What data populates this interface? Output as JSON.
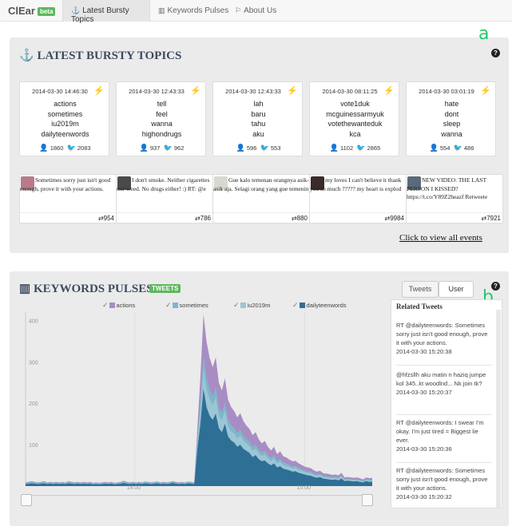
{
  "brand": {
    "name": "ClEar",
    "badge": "beta"
  },
  "nav": [
    {
      "label": "Latest Bursty Topics",
      "icon": "anchor-icon",
      "active": true
    },
    {
      "label": "Keywords Pulses",
      "icon": "bar-chart-icon",
      "active": false
    },
    {
      "label": "About Us",
      "icon": "bookmark-icon",
      "active": false
    }
  ],
  "bursty": {
    "title": "LATEST BURSTY TOPICS",
    "annotation": "a",
    "help": "?",
    "topics": [
      {
        "time": "2014-03-30 14:46:30",
        "bolt_color": "#f15a24",
        "words": [
          "actions",
          "sometimes",
          "iu2019m",
          "dailyteenwords"
        ],
        "users": "1860",
        "tweets": "2083"
      },
      {
        "time": "2014-03-30 12:43:33",
        "bolt_color": "#2ecc71",
        "words": [
          "tell",
          "feel",
          "wanna",
          "highondrugs"
        ],
        "users": "937",
        "tweets": "962"
      },
      {
        "time": "2014-03-30 12:43:33",
        "bolt_color": "#2ecc71",
        "words": [
          "lah",
          "baru",
          "tahu",
          "aku"
        ],
        "users": "596",
        "tweets": "553"
      },
      {
        "time": "2014-03-30 08:11:25",
        "bolt_color": "#f15a24",
        "words": [
          "vote1duk",
          "mcguinessarmyuk",
          "votethewanteduk",
          "kca"
        ],
        "users": "1102",
        "tweets": "2865"
      },
      {
        "time": "2014-03-30 03:01:19",
        "bolt_color": "#2ecc71",
        "words": [
          "hate",
          "dont",
          "sleep",
          "wanna"
        ],
        "users": "554",
        "tweets": "486"
      }
    ],
    "tweets": [
      {
        "text": "Sometimes sorry just isn't good enough, prove it with your actions.",
        "retweets": "954",
        "avatar_color": "#b97a8a"
      },
      {
        "text": "I don't smoke. Neither cigarettes nor weed. No drugs either! :) RT: @e",
        "retweets": "786",
        "avatar_color": "#4a4a4a"
      },
      {
        "text": "Gue kalo temenan orangnya asik-asik aja. Selagi orang yang gue temenin",
        "retweets": "880",
        "avatar_color": "#d8d8d0"
      },
      {
        "text": "my loves I can't believe it thank you so much ????? my heart is explod",
        "retweets": "9984",
        "avatar_color": "#3a2a2a"
      },
      {
        "text": "NEW VIDEO: THE LAST PERSON I KISSED? https://t.co/Y89Z2heazf Retweete",
        "retweets": "7921",
        "avatar_color": "#5a6a7a"
      }
    ],
    "view_all": "Click to view all events"
  },
  "pulses": {
    "title": "KEYWORDS PULSES",
    "badge": "TWEETS",
    "annotation": "b",
    "help": "?",
    "toggle": {
      "tweets": "Tweets",
      "user": "User"
    }
  },
  "chart_data": {
    "type": "area",
    "stacked": true,
    "x_ticks": [
      "14:00",
      "15:00"
    ],
    "y_ticks": [
      "100",
      "200",
      "300",
      "400"
    ],
    "ylim": [
      0,
      420
    ],
    "grid": true,
    "legend_position": "top",
    "series": [
      {
        "name": "dailyteenwords",
        "color": "#2e6f96",
        "values": [
          5,
          6,
          7,
          6,
          5,
          6,
          7,
          5,
          6,
          5,
          6,
          5,
          6,
          5,
          7,
          6,
          5,
          6,
          5,
          6,
          5,
          6,
          4,
          5,
          4,
          5,
          6,
          5,
          6,
          4,
          5,
          6,
          8,
          6,
          5,
          6,
          5,
          6,
          5,
          7,
          6,
          5,
          6,
          7,
          5,
          6,
          5,
          6,
          8,
          6,
          5,
          6,
          5,
          7,
          6,
          5,
          90,
          150,
          235,
          190,
          170,
          160,
          175,
          140,
          130,
          150,
          120,
          110,
          105,
          95,
          100,
          90,
          85,
          80,
          70,
          75,
          65,
          60,
          62,
          55,
          50,
          55,
          45,
          48,
          42,
          40,
          38,
          35,
          36,
          32,
          30,
          28,
          26,
          25,
          22,
          20,
          22,
          18,
          17,
          16,
          15,
          16,
          14,
          18,
          12,
          13,
          12,
          11,
          12,
          10,
          9,
          12,
          10,
          11
        ]
      },
      {
        "name": "iu2019m",
        "color": "#9cc5d5",
        "values": [
          1,
          1,
          2,
          1,
          1,
          1,
          2,
          1,
          1,
          1,
          1,
          1,
          1,
          1,
          2,
          1,
          1,
          1,
          1,
          1,
          1,
          1,
          1,
          1,
          1,
          1,
          1,
          1,
          1,
          1,
          1,
          1,
          2,
          1,
          1,
          1,
          1,
          1,
          1,
          1,
          1,
          1,
          1,
          1,
          1,
          1,
          1,
          1,
          1,
          1,
          1,
          1,
          1,
          1,
          1,
          1,
          20,
          35,
          50,
          45,
          40,
          35,
          40,
          30,
          28,
          32,
          25,
          22,
          22,
          20,
          22,
          20,
          18,
          17,
          15,
          16,
          14,
          13,
          14,
          12,
          11,
          12,
          10,
          11,
          9,
          9,
          8,
          8,
          8,
          7,
          7,
          6,
          6,
          6,
          5,
          5,
          5,
          4,
          4,
          4,
          4,
          4,
          4,
          5,
          3,
          3,
          3,
          3,
          3,
          3,
          2,
          3,
          3,
          3
        ]
      },
      {
        "name": "sometimes",
        "color": "#7fb6ca",
        "values": [
          2,
          2,
          2,
          2,
          2,
          2,
          2,
          2,
          2,
          2,
          2,
          2,
          2,
          2,
          2,
          2,
          2,
          2,
          2,
          2,
          2,
          2,
          2,
          2,
          2,
          2,
          2,
          2,
          2,
          2,
          2,
          2,
          2,
          2,
          2,
          2,
          2,
          2,
          2,
          2,
          2,
          2,
          2,
          2,
          2,
          2,
          2,
          2,
          2,
          2,
          2,
          2,
          2,
          2,
          2,
          2,
          10,
          20,
          30,
          28,
          25,
          22,
          24,
          20,
          18,
          20,
          16,
          15,
          14,
          13,
          14,
          12,
          11,
          11,
          10,
          10,
          9,
          8,
          9,
          8,
          7,
          8,
          6,
          7,
          6,
          6,
          5,
          5,
          5,
          5,
          4,
          4,
          4,
          4,
          3,
          3,
          3,
          3,
          3,
          3,
          3,
          3,
          3,
          3,
          2,
          2,
          2,
          2,
          2,
          2,
          2,
          2,
          2,
          2
        ]
      },
      {
        "name": "actions",
        "color": "#a88dc4",
        "values": [
          1,
          1,
          1,
          1,
          1,
          1,
          1,
          1,
          1,
          1,
          1,
          1,
          1,
          1,
          1,
          1,
          1,
          1,
          1,
          1,
          1,
          1,
          1,
          1,
          1,
          1,
          1,
          1,
          1,
          1,
          1,
          1,
          1,
          1,
          1,
          1,
          1,
          1,
          1,
          1,
          1,
          1,
          1,
          1,
          1,
          1,
          1,
          1,
          1,
          1,
          1,
          1,
          1,
          1,
          1,
          1,
          20,
          60,
          100,
          85,
          75,
          70,
          72,
          60,
          55,
          58,
          48,
          44,
          40,
          38,
          40,
          35,
          32,
          30,
          28,
          29,
          25,
          22,
          24,
          20,
          18,
          20,
          16,
          18,
          15,
          14,
          13,
          12,
          12,
          11,
          10,
          9,
          9,
          8,
          8,
          7,
          7,
          6,
          6,
          6,
          5,
          5,
          5,
          6,
          4,
          4,
          4,
          4,
          4,
          4,
          3,
          4,
          4,
          4
        ]
      }
    ]
  },
  "related": {
    "title": "Related Tweets",
    "items": [
      {
        "text": "RT @dailyteenwords: Sometimes sorry just isn't good enough, prove it with your actions.",
        "time": "2014-03-30 15:20:38"
      },
      {
        "text": "@hfzsllh aku matin n haziq jumpe kol 345..kt woodlnd... Nk join tk?",
        "time": "2014-03-30 15:20:37"
      },
      {
        "text": "RT @dailyteenwords: I swear I'm okay. I'm just tired = Biggest lie ever.",
        "time": "2014-03-30 15:20:36"
      },
      {
        "text": "RT @dailyteenwords: Sometimes sorry just isn't good enough, prove it with your actions.",
        "time": "2014-03-30 15:20:32"
      }
    ]
  }
}
